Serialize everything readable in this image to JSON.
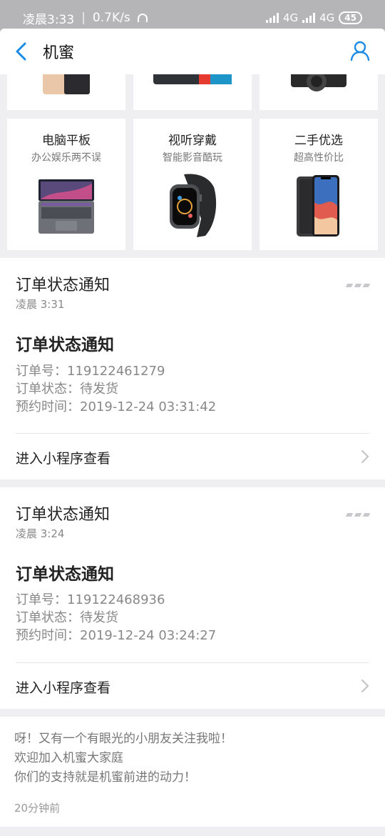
{
  "status_bar": {
    "time": "凌晨3:33",
    "separator": "|",
    "speed": "0.7K/s",
    "network1": "4G",
    "network2": "4G",
    "battery": "45"
  },
  "nav": {
    "title": "机蜜"
  },
  "categories": [
    {
      "title": "电脑平板",
      "subtitle": "办公娱乐两不误",
      "icon": "laptop-image"
    },
    {
      "title": "视听穿戴",
      "subtitle": "智能影音酷玩",
      "icon": "smartwatch-image"
    },
    {
      "title": "二手优选",
      "subtitle": "超高性价比",
      "icon": "phone-image"
    }
  ],
  "cards": [
    {
      "header": "订单状态通知",
      "time": "凌晨 3:31",
      "title": "订单状态通知",
      "order_no": "订单号：119122461279",
      "status": "订单状态：待发货",
      "reserve_time": "预约时间：2019-12-24 03:31:42",
      "link": "进入小程序查看"
    },
    {
      "header": "订单状态通知",
      "time": "凌晨 3:24",
      "title": "订单状态通知",
      "order_no": "订单号：119122468936",
      "status": "订单状态：待发货",
      "reserve_time": "预约时间：2019-12-24 03:24:27",
      "link": "进入小程序查看"
    }
  ],
  "message": {
    "line1": "呀！又有一个有眼光的小朋友关注我啦！",
    "line2": "欢迎加入机蜜大家庭",
    "line3": "你们的支持就是机蜜前进的动力！",
    "ago": "20分钟前"
  },
  "colors": {
    "accent": "#1a8ae5",
    "background": "#efeff1"
  }
}
